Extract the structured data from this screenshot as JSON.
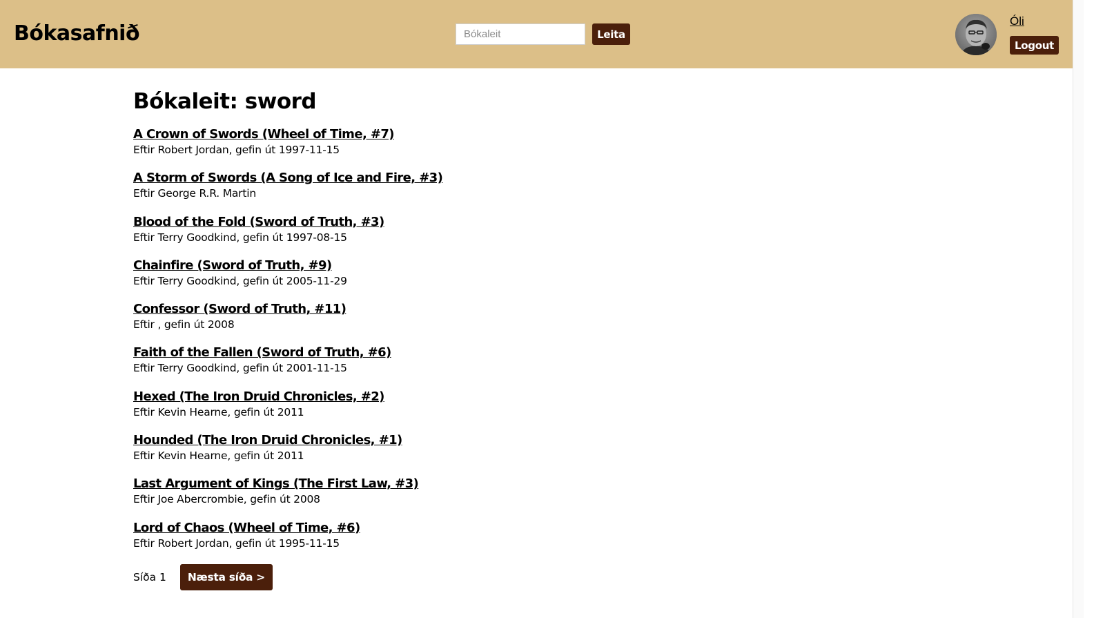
{
  "header": {
    "brand": "Bókasafnið",
    "search": {
      "placeholder": "Bókaleit",
      "value": "",
      "button_label": "Leita"
    },
    "user": {
      "name": "Óli",
      "logout_label": "Logout"
    }
  },
  "main": {
    "title": "Bókaleit: sword",
    "results": [
      {
        "title": "A Crown of Swords (Wheel of Time, #7)",
        "meta": "Eftir Robert Jordan, gefin út 1997-11-15"
      },
      {
        "title": "A Storm of Swords (A Song of Ice and Fire, #3)",
        "meta": "Eftir George R.R. Martin"
      },
      {
        "title": "Blood of the Fold (Sword of Truth, #3)",
        "meta": "Eftir Terry Goodkind, gefin út 1997-08-15"
      },
      {
        "title": "Chainfire (Sword of Truth, #9)",
        "meta": "Eftir Terry Goodkind, gefin út 2005-11-29"
      },
      {
        "title": "Confessor (Sword of Truth, #11)",
        "meta": "Eftir , gefin út 2008"
      },
      {
        "title": "Faith of the Fallen (Sword of Truth, #6)",
        "meta": "Eftir Terry Goodkind, gefin út 2001-11-15"
      },
      {
        "title": "Hexed (The Iron Druid Chronicles, #2)",
        "meta": "Eftir Kevin Hearne, gefin út 2011"
      },
      {
        "title": "Hounded (The Iron Druid Chronicles, #1)",
        "meta": "Eftir Kevin Hearne, gefin út 2011"
      },
      {
        "title": "Last Argument of Kings (The First Law, #3)",
        "meta": "Eftir Joe Abercrombie, gefin út 2008"
      },
      {
        "title": "Lord of Chaos (Wheel of Time, #6)",
        "meta": "Eftir Robert Jordan, gefin út 1995-11-15"
      }
    ]
  },
  "pagination": {
    "page_label": "Síða 1",
    "next_label": "Næsta síða >"
  },
  "colors": {
    "header_bg": "#dcbf88",
    "button_bg": "#4b1f0b",
    "button_text": "#ffffff"
  },
  "icons": {
    "avatar": "user-avatar-photo"
  }
}
